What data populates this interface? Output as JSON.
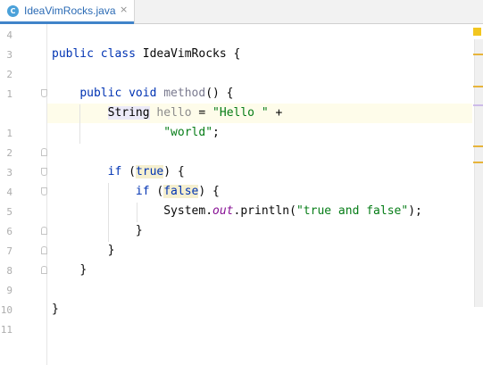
{
  "tab": {
    "icon_letter": "C",
    "title": "IdeaVimRocks.java",
    "close_glyph": "×",
    "accent": "#4083c9"
  },
  "gutter": {
    "line_numbers": [
      "4",
      "3",
      "2",
      "1",
      "",
      "1",
      "2",
      "3",
      "4",
      "5",
      "6",
      "7",
      "8",
      "9",
      "10",
      "11"
    ]
  },
  "code": {
    "class_kw": "public class",
    "class_name": "IdeaVimRocks",
    "class_open": " {",
    "method_kw": "public void",
    "method_name": "method",
    "method_rest": "() {",
    "string_type": "String",
    "var_name": "hello",
    "assign": " = ",
    "str1": "\"Hello \"",
    "plus": " +",
    "str2": "\"world\"",
    "semi": ";",
    "if1_kw": "if",
    "if1_open": " (",
    "if1_cond": "true",
    "if1_close": ") {",
    "if2_kw": "if",
    "if2_open": " (",
    "if2_cond": "false",
    "if2_close": ") {",
    "println_obj": "System.",
    "println_field": "out",
    "println_call": ".println(",
    "println_arg": "\"true and false\"",
    "println_end": ");",
    "brace": "}"
  },
  "colors": {
    "keyword": "#0033b3",
    "string": "#067d17",
    "field": "#871094",
    "caret_row": "#fefcea",
    "warning": "#f2c61f"
  }
}
